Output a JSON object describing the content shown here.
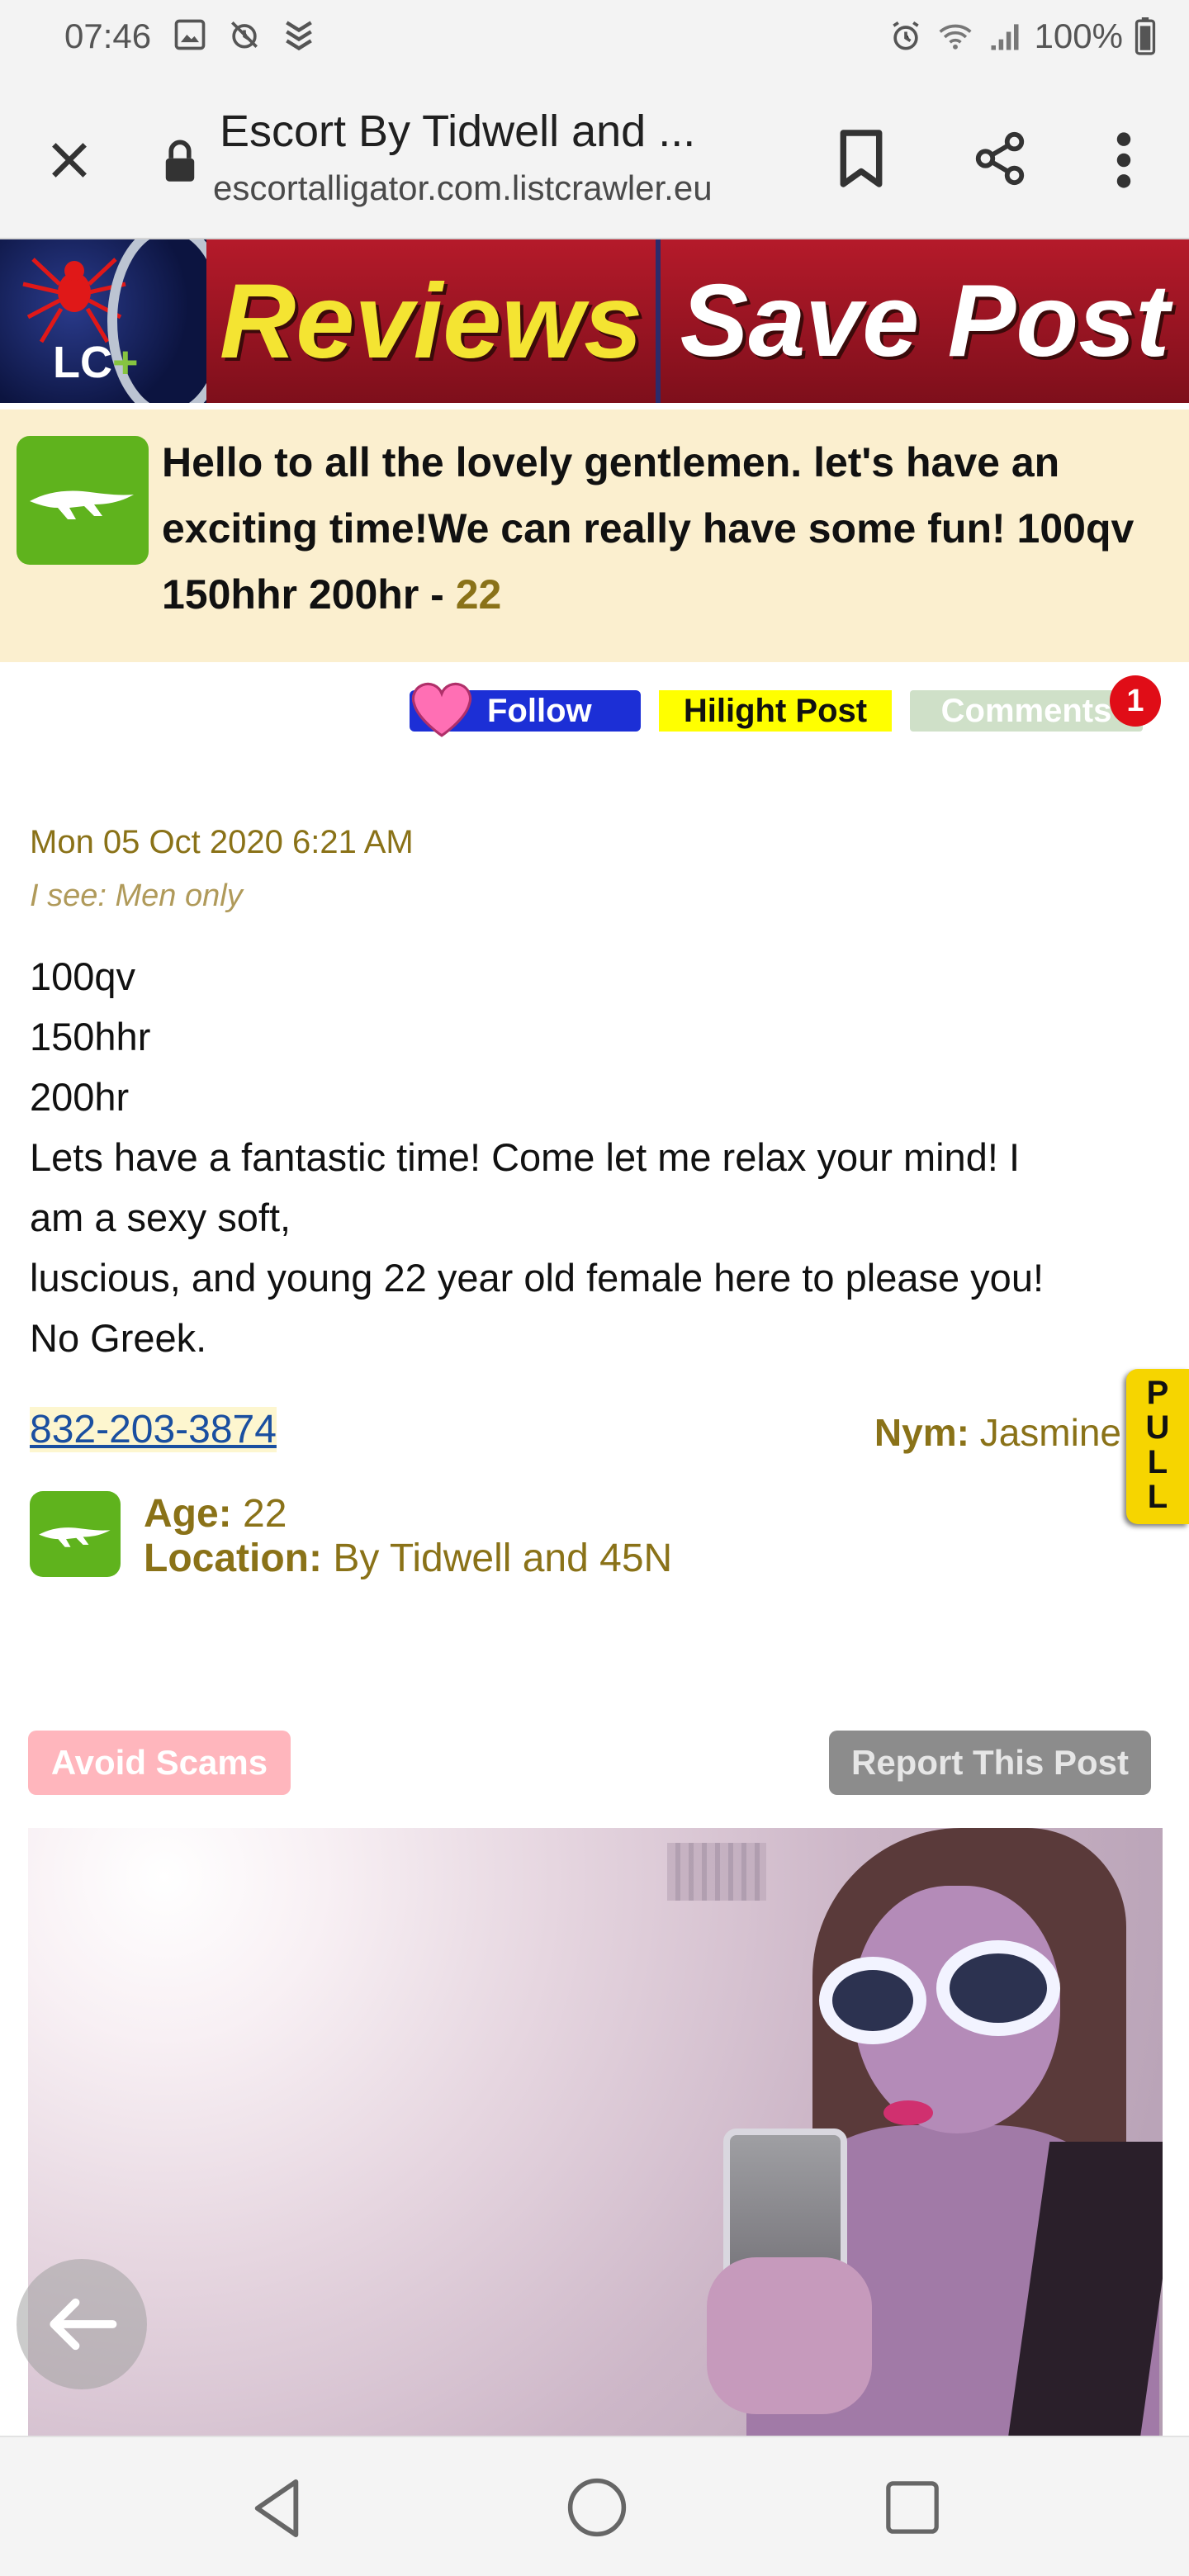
{
  "status_bar": {
    "time": "07:46",
    "battery": "100%",
    "icons": [
      "gallery-icon",
      "alarm-off-icon",
      "chevron-stack-icon",
      "alarm-icon",
      "wifi-icon",
      "signal-icon",
      "battery-icon"
    ]
  },
  "browser": {
    "page_title": "Escort By Tidwell and ...",
    "url": "escortalligator.com.listcrawler.eu",
    "icons": [
      "close-icon",
      "lock-icon",
      "bookmark-icon",
      "share-icon",
      "more-vert-icon"
    ]
  },
  "banner": {
    "logo_text": "LC",
    "logo_plus": "+",
    "reviews_label": "Reviews",
    "save_label": "Save Post"
  },
  "post": {
    "headline": "Hello to all the lovely gentlemen. let's have an exciting time!We can really have some fun! 100qv 150hhr 200hr - ",
    "headline_age": "22",
    "follow_label": "Follow",
    "hilight_label": "Hilight Post",
    "comments_label": "Comments",
    "comments_count": "1",
    "date": "Mon 05 Oct 2020 6:21 AM",
    "seeking": "I see: Men only",
    "body_lines": [
      "100qv",
      "150hhr",
      "200hr",
      "Lets have a fantastic time! Come let me relax your mind! I",
      "am a sexy soft,",
      "luscious, and young 22 year old female here to please you!",
      "No Greek."
    ],
    "phone": "832-203-3874",
    "nym_label": "Nym:",
    "nym_value": "Jasmine",
    "pull_label": "PULL",
    "age_label": "Age:",
    "age_value": "22",
    "location_label": "Location:",
    "location_value": "By Tidwell and 45N",
    "avoid_scams_label": "Avoid Scams",
    "report_label": "Report This Post"
  },
  "colors": {
    "header_bg": "#fbefcf",
    "gold_text": "#8a7218",
    "gator_green": "#5fb31d",
    "follow_blue": "#1c2fd6",
    "hilight_yellow": "#ffff00",
    "badge_red": "#e00d17"
  }
}
